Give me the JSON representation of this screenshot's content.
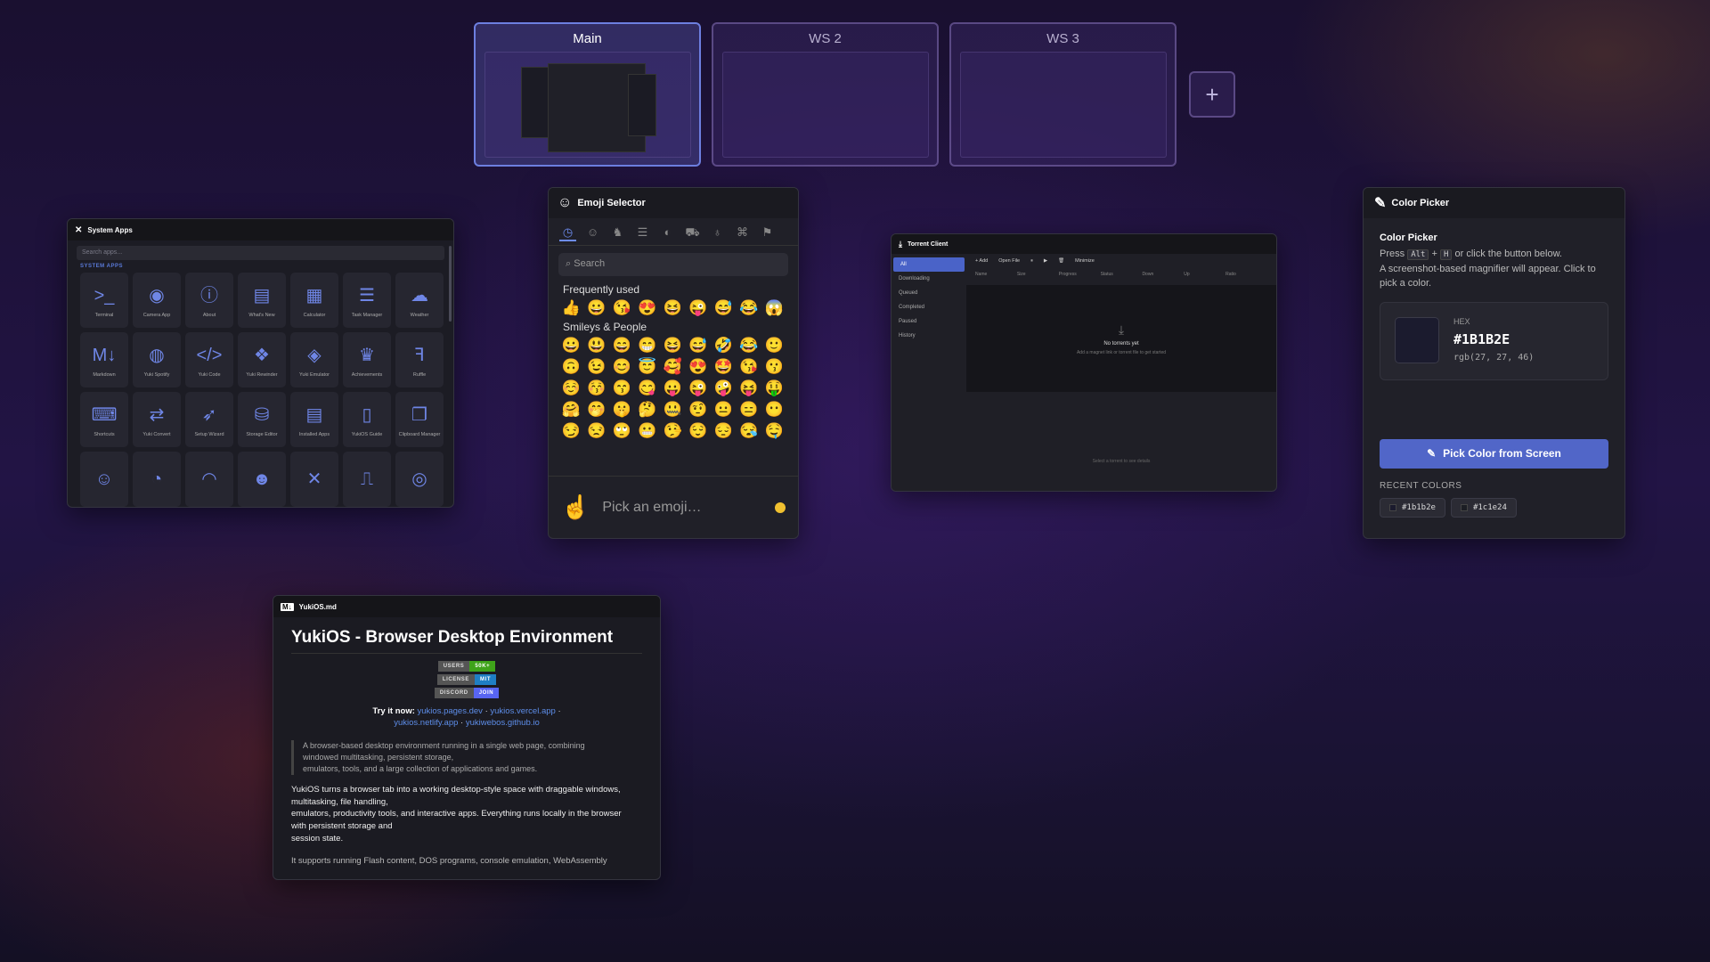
{
  "workspaces": {
    "items": [
      {
        "label": "Main"
      },
      {
        "label": "WS 2"
      },
      {
        "label": "WS 3"
      }
    ],
    "add_label": "+"
  },
  "system_apps": {
    "title": "System Apps",
    "search_placeholder": "Search apps...",
    "section": "SYSTEM APPS",
    "apps": [
      {
        "label": "Terminal",
        "icon": "terminal-icon",
        "glyph": ">_"
      },
      {
        "label": "Camera App",
        "icon": "camera-icon",
        "glyph": "◉"
      },
      {
        "label": "About",
        "icon": "info-icon",
        "glyph": "ⓘ"
      },
      {
        "label": "What's New",
        "icon": "news-icon",
        "glyph": "▤"
      },
      {
        "label": "Calculator",
        "icon": "calculator-icon",
        "glyph": "▦"
      },
      {
        "label": "Task Manager",
        "icon": "tasks-icon",
        "glyph": "☰"
      },
      {
        "label": "Weather",
        "icon": "cloud-icon",
        "glyph": "☁"
      },
      {
        "label": "Markdown",
        "icon": "markdown-icon",
        "glyph": "M↓"
      },
      {
        "label": "Yuki Spotify",
        "icon": "spotify-icon",
        "glyph": "◍"
      },
      {
        "label": "Yuki Code",
        "icon": "code-icon",
        "glyph": "</>"
      },
      {
        "label": "Yuki Rewinder",
        "icon": "rewinder-icon",
        "glyph": "❖"
      },
      {
        "label": "Yuki Emulator",
        "icon": "emulator-icon",
        "glyph": "◈"
      },
      {
        "label": "Achievements",
        "icon": "trophy-icon",
        "glyph": "♛"
      },
      {
        "label": "Ruffle",
        "icon": "ruffle-icon",
        "glyph": "ꟻ"
      },
      {
        "label": "Shortcuts",
        "icon": "keyboard-icon",
        "glyph": "⌨"
      },
      {
        "label": "Yuki Convert",
        "icon": "convert-icon",
        "glyph": "⇄"
      },
      {
        "label": "Setup Wizard",
        "icon": "rocket-icon",
        "glyph": "➶"
      },
      {
        "label": "Storage Editor",
        "icon": "database-icon",
        "glyph": "⛁"
      },
      {
        "label": "Installed Apps",
        "icon": "list-icon",
        "glyph": "▤"
      },
      {
        "label": "YukiOS Guide",
        "icon": "book-icon",
        "glyph": "▯"
      },
      {
        "label": "Clipboard Manager",
        "icon": "clipboard-icon",
        "glyph": "❐"
      },
      {
        "label": "",
        "icon": "robot-icon",
        "glyph": "☺"
      },
      {
        "label": "",
        "icon": "gauge-icon",
        "glyph": "◔"
      },
      {
        "label": "",
        "icon": "wifi-icon",
        "glyph": "◠"
      },
      {
        "label": "",
        "icon": "smiley-icon",
        "glyph": "☻"
      },
      {
        "label": "",
        "icon": "tools-icon",
        "glyph": "✕"
      },
      {
        "label": "",
        "icon": "signal-icon",
        "glyph": "⎍"
      },
      {
        "label": "",
        "icon": "globe-icon",
        "glyph": "◎"
      }
    ]
  },
  "emoji_selector": {
    "title": "Emoji Selector",
    "search_placeholder": "Search",
    "frequent_label": "Frequently used",
    "frequent": [
      "👍",
      "😀",
      "😘",
      "😍",
      "😆",
      "😜",
      "😅",
      "😂",
      "😱"
    ],
    "smileys_label": "Smileys & People",
    "smileys": [
      [
        "😀",
        "😃",
        "😄",
        "😁",
        "😆",
        "😅",
        "🤣",
        "😂",
        "🙂"
      ],
      [
        "🙃",
        "😉",
        "😊",
        "😇",
        "🥰",
        "😍",
        "🤩",
        "😘",
        "😗"
      ],
      [
        "☺️",
        "😚",
        "😙",
        "😋",
        "😛",
        "😜",
        "🤪",
        "😝",
        "🤑"
      ],
      [
        "🤗",
        "🤭",
        "🤫",
        "🤔",
        "🤐",
        "🤨",
        "😐",
        "😑",
        "😶"
      ],
      [
        "😏",
        "😒",
        "🙄",
        "😬",
        "🤥",
        "😌",
        "😔",
        "😪",
        "🤤"
      ]
    ],
    "preview_emoji": "☝️",
    "preview_placeholder": "Pick an emoji…"
  },
  "torrent": {
    "title": "Torrent Client",
    "sidebar": [
      "All",
      "Downloading",
      "Queued",
      "Completed",
      "Paused",
      "History"
    ],
    "toolbar": [
      "+ Add",
      "Open File",
      "⏸",
      "▶",
      "🗑",
      "Minimize"
    ],
    "columns": [
      "Name",
      "Size",
      "Progress",
      "Status",
      "Down",
      "Up",
      "Ratio"
    ],
    "empty_title": "No torrents yet",
    "empty_sub": "Add a magnet link or torrent file to get started",
    "select_hint": "Select a torrent to see details"
  },
  "color_picker": {
    "title": "Color Picker",
    "heading": "Color Picker",
    "press": "Press",
    "key1": "Alt",
    "plus": "+",
    "key2": "H",
    "instr1": "or click the button below.",
    "instr2": "A screenshot-based magnifier will appear. Click to pick a color.",
    "hex_label": "HEX",
    "hex_value": "#1B1B2E",
    "rgb_value": "rgb(27, 27, 46)",
    "swatch_color": "#1b1b2e",
    "button": "Pick Color from Screen",
    "recent_label": "RECENT COLORS",
    "recent": [
      "#1b1b2e",
      "#1c1e24"
    ]
  },
  "markdown": {
    "title": "YukiOS.md",
    "h1": "YukiOS - Browser Desktop Environment",
    "badges": [
      {
        "k": "USERS",
        "v": "50K+",
        "color": "#3fa31a"
      },
      {
        "k": "LICENSE",
        "v": "MIT",
        "color": "#1f7fc4"
      },
      {
        "k": "DISCORD",
        "v": "JOIN",
        "color": "#5865f2"
      }
    ],
    "try_label": "Try it now:",
    "links": [
      "yukios.pages.dev",
      "yukios.vercel.app",
      "yukios.netlify.app",
      "yukiwebos.github.io"
    ],
    "sep": "·",
    "quote": [
      "A browser-based desktop environment running in a single web page, combining",
      "windowed multitasking, persistent storage,",
      "emulators, tools, and a large collection of applications and games."
    ],
    "para": [
      "YukiOS turns a browser tab into a working desktop-style space with draggable windows,",
      "multitasking, file handling,",
      "emulators, productivity tools, and interactive apps. Everything runs locally in the browser",
      "with persistent storage and",
      "session state."
    ],
    "para2": "It supports running Flash content, DOS programs, console emulation, WebAssembly"
  }
}
